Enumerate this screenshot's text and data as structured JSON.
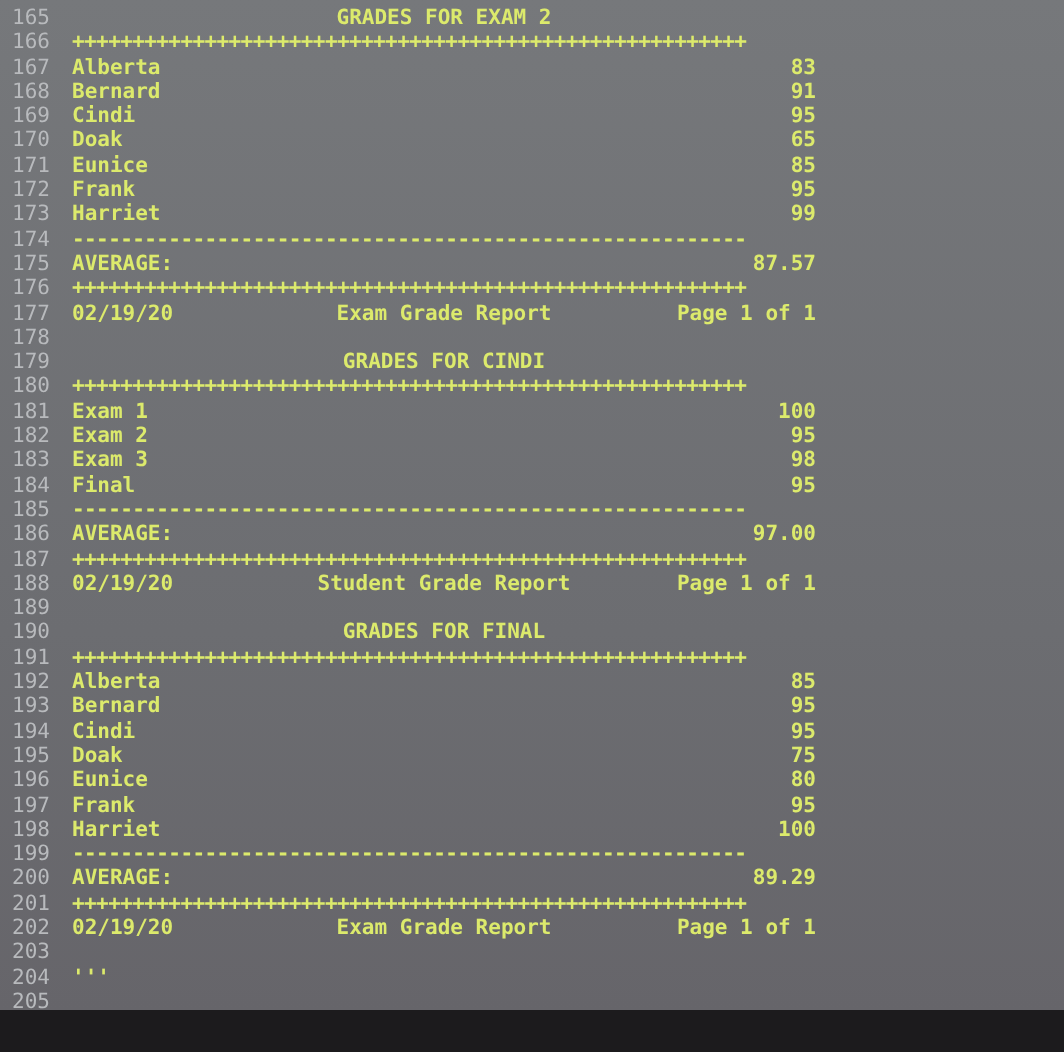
{
  "lines": [
    {
      "number": "165",
      "kind": "title",
      "text": "GRADES FOR EXAM 2"
    },
    {
      "number": "166",
      "kind": "rule",
      "text": "++++++++++++++++++++++++++++++++++++++++++++++++++++++++"
    },
    {
      "number": "167",
      "kind": "row",
      "label": "Alberta",
      "value": "83"
    },
    {
      "number": "168",
      "kind": "row",
      "label": "Bernard",
      "value": "91"
    },
    {
      "number": "169",
      "kind": "row",
      "label": "Cindi",
      "value": "95"
    },
    {
      "number": "170",
      "kind": "row",
      "label": "Doak",
      "value": "65"
    },
    {
      "number": "171",
      "kind": "row",
      "label": "Eunice",
      "value": "85"
    },
    {
      "number": "172",
      "kind": "row",
      "label": "Frank",
      "value": "95"
    },
    {
      "number": "173",
      "kind": "row",
      "label": "Harriet",
      "value": "99"
    },
    {
      "number": "174",
      "kind": "rule",
      "text": "--------------------------------------------------------"
    },
    {
      "number": "175",
      "kind": "row",
      "label": "AVERAGE:",
      "value": "87.57"
    },
    {
      "number": "176",
      "kind": "rule",
      "text": "++++++++++++++++++++++++++++++++++++++++++++++++++++++++"
    },
    {
      "number": "177",
      "kind": "footer",
      "date": "02/19/20",
      "report": "Exam Grade Report",
      "page": "Page 1 of 1"
    },
    {
      "number": "178",
      "kind": "blank"
    },
    {
      "number": "179",
      "kind": "title",
      "text": "GRADES FOR CINDI"
    },
    {
      "number": "180",
      "kind": "rule",
      "text": "++++++++++++++++++++++++++++++++++++++++++++++++++++++++"
    },
    {
      "number": "181",
      "kind": "row",
      "label": "Exam 1",
      "value": "100"
    },
    {
      "number": "182",
      "kind": "row",
      "label": "Exam 2",
      "value": "95"
    },
    {
      "number": "183",
      "kind": "row",
      "label": "Exam 3",
      "value": "98"
    },
    {
      "number": "184",
      "kind": "row",
      "label": "Final",
      "value": "95"
    },
    {
      "number": "185",
      "kind": "rule",
      "text": "--------------------------------------------------------"
    },
    {
      "number": "186",
      "kind": "row",
      "label": "AVERAGE:",
      "value": "97.00"
    },
    {
      "number": "187",
      "kind": "rule",
      "text": "++++++++++++++++++++++++++++++++++++++++++++++++++++++++"
    },
    {
      "number": "188",
      "kind": "footer",
      "date": "02/19/20",
      "report": "Student Grade Report",
      "page": "Page 1 of 1"
    },
    {
      "number": "189",
      "kind": "blank"
    },
    {
      "number": "190",
      "kind": "title",
      "text": "GRADES FOR FINAL"
    },
    {
      "number": "191",
      "kind": "rule",
      "text": "++++++++++++++++++++++++++++++++++++++++++++++++++++++++"
    },
    {
      "number": "192",
      "kind": "row",
      "label": "Alberta",
      "value": "85"
    },
    {
      "number": "193",
      "kind": "row",
      "label": "Bernard",
      "value": "95"
    },
    {
      "number": "194",
      "kind": "row",
      "label": "Cindi",
      "value": "95"
    },
    {
      "number": "195",
      "kind": "row",
      "label": "Doak",
      "value": "75"
    },
    {
      "number": "196",
      "kind": "row",
      "label": "Eunice",
      "value": "80"
    },
    {
      "number": "197",
      "kind": "row",
      "label": "Frank",
      "value": "95"
    },
    {
      "number": "198",
      "kind": "row",
      "label": "Harriet",
      "value": "100"
    },
    {
      "number": "199",
      "kind": "rule",
      "text": "--------------------------------------------------------"
    },
    {
      "number": "200",
      "kind": "row",
      "label": "AVERAGE:",
      "value": "89.29"
    },
    {
      "number": "201",
      "kind": "rule",
      "text": "++++++++++++++++++++++++++++++++++++++++++++++++++++++++"
    },
    {
      "number": "202",
      "kind": "footer",
      "date": "02/19/20",
      "report": "Exam Grade Report",
      "page": "Page 1 of 1"
    },
    {
      "number": "203",
      "kind": "blank"
    },
    {
      "number": "204",
      "kind": "text",
      "text": "'''"
    },
    {
      "number": "205",
      "kind": "blank"
    }
  ]
}
